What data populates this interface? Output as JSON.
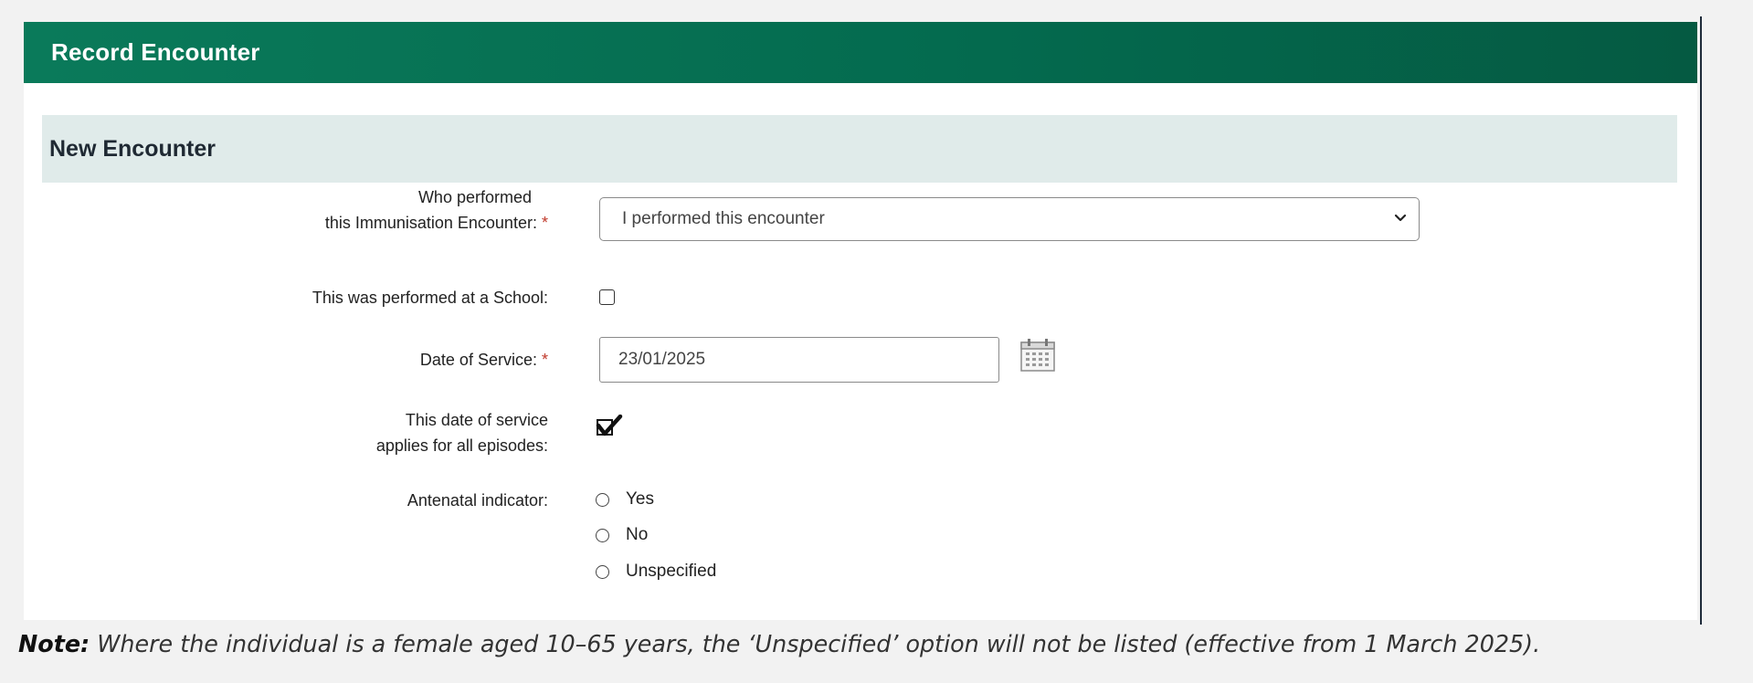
{
  "window": {
    "title": "Record Encounter"
  },
  "section": {
    "title": "New Encounter"
  },
  "form": {
    "performer": {
      "label_line1": "Who performed",
      "label_line2": "this Immunisation Encounter:",
      "required_mark": "*",
      "selected_value": "I performed this encounter"
    },
    "school": {
      "label": "This was performed at a School:",
      "checked": false
    },
    "date_of_service": {
      "label": "Date of Service:",
      "required_mark": "*",
      "value": "23/01/2025",
      "icon": "calendar-icon"
    },
    "applies_all": {
      "label_line1": "This date of service",
      "label_line2": "applies for all episodes:",
      "checked": true
    },
    "antenatal": {
      "label": "Antenatal indicator:",
      "options": [
        "Yes",
        "No",
        "Unspecified"
      ]
    }
  },
  "note": {
    "prefix": "Note:",
    "text": " Where the individual is a female aged 10–65 years, the ‘Unspecified’ option will not be listed (effective from 1 March 2025)."
  },
  "colors": {
    "header_bg": "#046b4f",
    "section_bg": "#e0ebea",
    "required": "#c0392b"
  }
}
